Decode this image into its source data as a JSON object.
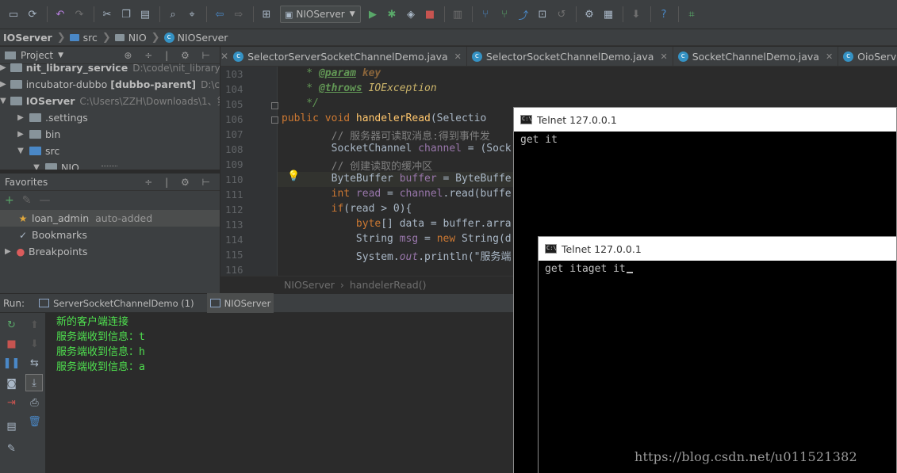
{
  "toolbar": {
    "run_config": "NIOServer"
  },
  "breadcrumb": {
    "items": [
      "IOServer",
      "src",
      "NIO",
      "NIOServer"
    ]
  },
  "project_panel": {
    "title": "Project",
    "rows": [
      {
        "name": "nit_library_service",
        "path": "D:\\code\\nit_library_se"
      },
      {
        "name": "incubator-dubbo",
        "module": "[dubbo-parent]",
        "path": "D:\\co"
      },
      {
        "name": "IOServer",
        "path": "C:\\Users\\ZZH\\Downloads\\1、第"
      },
      {
        "name": ".settings"
      },
      {
        "name": "bin"
      },
      {
        "name": "src"
      },
      {
        "name": "NIO"
      }
    ]
  },
  "favorites_panel": {
    "title": "Favorites",
    "items": [
      {
        "label": "loan_admin",
        "note": "auto-added"
      },
      {
        "label": "Bookmarks"
      },
      {
        "label": "Breakpoints"
      }
    ]
  },
  "editor_tabs": [
    "SelectorServerSocketChannelDemo.java",
    "SelectorSocketChannelDemo.java",
    "SocketChannelDemo.java",
    "OioServer.java"
  ],
  "editor": {
    "line_numbers": [
      "103",
      "104",
      "105",
      "106",
      "107",
      "108",
      "109",
      "110",
      "111",
      "112",
      "113",
      "114",
      "115",
      "116"
    ],
    "lines": [
      {
        "indent": "    * ",
        "tag": "@param",
        "rest": " key"
      },
      {
        "indent": "    * ",
        "tag": "@throws",
        "rest": " IOException"
      },
      {
        "text": "    */"
      },
      {
        "kw": "public void ",
        "fn": "handelerRead",
        "rest": "(Selectio"
      },
      {
        "comment": "        // 服务器可读取消息:得到事件发"
      },
      {
        "pre": "        SocketChannel ",
        "var": "channel",
        "rest": " = (Sock"
      },
      {
        "comment": "        // 创建读取的缓冲区"
      },
      {
        "pre": "        ByteBuffer ",
        "var": "buffer",
        "rest": " = ByteBuffe"
      },
      {
        "kw": "        int ",
        "var": "read",
        "mid": " = ",
        "var2": "channel",
        "rest": ".read(buffe"
      },
      {
        "kw": "        if",
        "rest": "(read > 0){"
      },
      {
        "kw": "            byte",
        "rest": "[] data = buffer.arra"
      },
      {
        "pre": "            String ",
        "var": "msg",
        "mid": " = ",
        "kw": "new ",
        "rest": "String(d"
      },
      {
        "pre": "            System.",
        "var": "out",
        "rest": ".println(\"服务端"
      },
      {
        "text": ""
      }
    ]
  },
  "editor_crumb": {
    "class": "NIOServer",
    "method": "handelerRead()"
  },
  "run": {
    "label": "Run:",
    "tabs": [
      "ServerSocketChannelDemo (1)",
      "NIOServer"
    ],
    "console": [
      "新的客户端连接",
      "服务端收到信息：t",
      "服务端收到信息：h",
      "服务端收到信息：a"
    ]
  },
  "telnet_windows": [
    {
      "title": "Telnet 127.0.0.1",
      "content": "get it"
    },
    {
      "title": "Telnet 127.0.0.1",
      "content": "get itaget it"
    }
  ],
  "watermark": "https://blog.csdn.net/u011521382"
}
